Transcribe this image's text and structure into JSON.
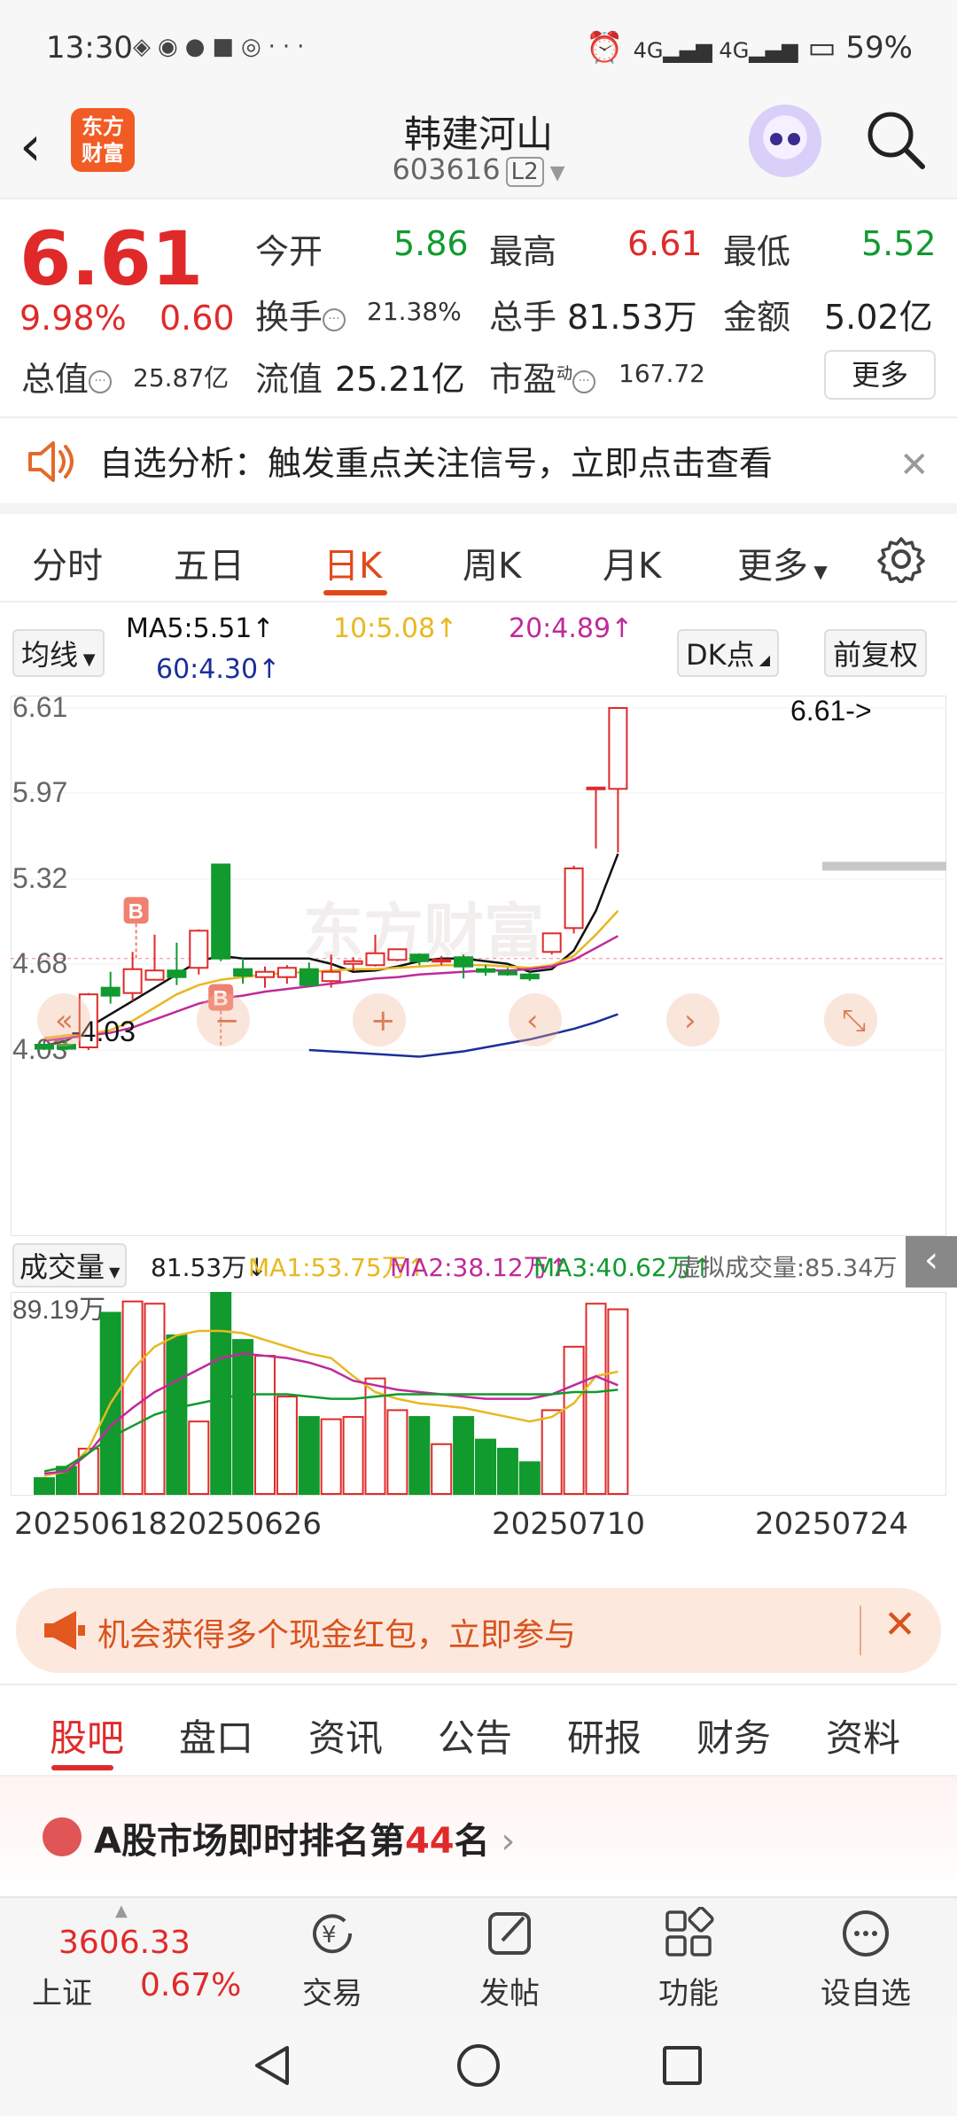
{
  "status_bar": {
    "time": "13:30",
    "battery": "59%",
    "more": "···"
  },
  "header": {
    "logo_line1": "东方",
    "logo_line2": "财富",
    "stock_name": "韩建河山",
    "stock_code": "603616",
    "level": "L2"
  },
  "quote": {
    "price": "6.61",
    "change_pct": "9.98%",
    "change_amt": "0.60",
    "open_label": "今开",
    "open": "5.86",
    "high_label": "最高",
    "high": "6.61",
    "low_label": "最低",
    "low": "5.52",
    "turnover_label": "换手",
    "turnover": "21.38%",
    "volume_label": "总手",
    "volume": "81.53万",
    "amount_label": "金额",
    "amount": "5.02亿",
    "mktcap_label": "总值",
    "mktcap": "25.87亿",
    "float_label": "流值",
    "float": "25.21亿",
    "pe_label": "市盈",
    "pe_sup": "动",
    "pe": "167.72",
    "more": "更多"
  },
  "alert": {
    "text": "自选分析：触发重点关注信号，立即点击查看"
  },
  "kline_tabs": [
    "分时",
    "五日",
    "日K",
    "周K",
    "月K",
    "更多"
  ],
  "ma_legend": {
    "selector": "均线",
    "ma5": "MA5:5.51↑",
    "ma10": "10:5.08↑",
    "ma20": "20:4.89↑",
    "ma60": "60:4.30↑",
    "dk": "DK点",
    "adjust": "前复权"
  },
  "colors": {
    "up": "#e02a2a",
    "down": "#119a2e",
    "ma5": "#111111",
    "ma10": "#e8b820",
    "ma20": "#c02a9a",
    "ma60": "#1a2f9a"
  },
  "chart_data": {
    "type": "candlestick",
    "y_ticks": [
      "6.61",
      "5.97",
      "5.32",
      "4.68",
      "4.03"
    ],
    "ylim": [
      4.03,
      6.61
    ],
    "current_marker": "6.61->",
    "low_marker": "4.03",
    "badge_b": "B",
    "watermark": "东方财富",
    "candles": [
      {
        "o": 4.07,
        "h": 4.1,
        "l": 4.03,
        "c": 4.04
      },
      {
        "o": 4.07,
        "h": 4.1,
        "l": 4.03,
        "c": 4.04
      },
      {
        "o": 4.05,
        "h": 4.46,
        "l": 4.03,
        "c": 4.45
      },
      {
        "o": 4.5,
        "h": 4.62,
        "l": 4.38,
        "c": 4.44
      },
      {
        "o": 4.46,
        "h": 4.77,
        "l": 4.4,
        "c": 4.64
      },
      {
        "o": 4.56,
        "h": 4.9,
        "l": 4.56,
        "c": 4.63
      },
      {
        "o": 4.63,
        "h": 4.84,
        "l": 4.52,
        "c": 4.58
      },
      {
        "o": 4.65,
        "h": 4.94,
        "l": 4.6,
        "c": 4.93
      },
      {
        "o": 5.43,
        "h": 5.43,
        "l": 4.7,
        "c": 4.72
      },
      {
        "o": 4.64,
        "h": 4.72,
        "l": 4.53,
        "c": 4.59
      },
      {
        "o": 4.58,
        "h": 4.66,
        "l": 4.5,
        "c": 4.62
      },
      {
        "o": 4.58,
        "h": 4.67,
        "l": 4.53,
        "c": 4.65
      },
      {
        "o": 4.64,
        "h": 4.69,
        "l": 4.51,
        "c": 4.52
      },
      {
        "o": 4.55,
        "h": 4.75,
        "l": 4.5,
        "c": 4.62
      },
      {
        "o": 4.68,
        "h": 4.73,
        "l": 4.63,
        "c": 4.7
      },
      {
        "o": 4.67,
        "h": 4.9,
        "l": 4.66,
        "c": 4.76
      },
      {
        "o": 4.71,
        "h": 4.79,
        "l": 4.7,
        "c": 4.79
      },
      {
        "o": 4.75,
        "h": 4.76,
        "l": 4.67,
        "c": 4.7
      },
      {
        "o": 4.71,
        "h": 4.74,
        "l": 4.67,
        "c": 4.71
      },
      {
        "o": 4.73,
        "h": 4.75,
        "l": 4.57,
        "c": 4.66
      },
      {
        "o": 4.64,
        "h": 4.67,
        "l": 4.59,
        "c": 4.62
      },
      {
        "o": 4.62,
        "h": 4.65,
        "l": 4.59,
        "c": 4.6
      },
      {
        "o": 4.6,
        "h": 4.62,
        "l": 4.55,
        "c": 4.57
      },
      {
        "o": 4.77,
        "h": 4.9,
        "l": 4.75,
        "c": 4.91
      },
      {
        "o": 4.95,
        "h": 5.42,
        "l": 4.91,
        "c": 5.4
      },
      {
        "o": 6.01,
        "h": 6.01,
        "l": 5.55,
        "c": 6.01
      },
      {
        "o": 6.0,
        "h": 6.61,
        "l": 5.52,
        "c": 6.61
      }
    ],
    "ma5": [
      4.06,
      4.1,
      4.2,
      4.3,
      4.4,
      4.5,
      4.6,
      4.7,
      4.74,
      4.72,
      4.72,
      4.72,
      4.72,
      4.68,
      4.62,
      4.63,
      4.66,
      4.7,
      4.72,
      4.72,
      4.7,
      4.68,
      4.62,
      4.64,
      4.78,
      5.08,
      5.51
    ],
    "ma10": [
      4.12,
      4.14,
      4.15,
      4.18,
      4.25,
      4.35,
      4.45,
      4.52,
      4.56,
      4.58,
      4.6,
      4.61,
      4.62,
      4.63,
      4.64,
      4.64,
      4.65,
      4.66,
      4.67,
      4.67,
      4.67,
      4.66,
      4.65,
      4.67,
      4.74,
      4.9,
      5.08
    ],
    "ma20": [
      4.1,
      4.12,
      4.14,
      4.16,
      4.2,
      4.26,
      4.32,
      4.38,
      4.42,
      4.44,
      4.47,
      4.49,
      4.51,
      4.53,
      4.55,
      4.57,
      4.58,
      4.6,
      4.61,
      4.62,
      4.63,
      4.63,
      4.64,
      4.66,
      4.71,
      4.8,
      4.89
    ],
    "ma60": [
      null,
      null,
      null,
      null,
      null,
      null,
      null,
      null,
      null,
      null,
      null,
      null,
      null,
      null,
      null,
      null,
      null,
      3.98,
      4.0,
      4.02,
      4.05,
      4.08,
      4.11,
      4.15,
      4.19,
      4.24,
      4.3
    ],
    "volume": {
      "label": "成交量",
      "current": "81.53万↓",
      "ma1": [
        8,
        10,
        20,
        40,
        55,
        65,
        70,
        72,
        72,
        71,
        68,
        65,
        62,
        60,
        52,
        45,
        42,
        40,
        39,
        38,
        36,
        34,
        32,
        34,
        40,
        52,
        54
      ],
      "ma2": [
        9,
        10,
        18,
        30,
        38,
        45,
        50,
        55,
        60,
        62,
        61,
        60,
        58,
        55,
        50,
        48,
        46,
        45,
        44,
        43,
        42,
        42,
        42,
        44,
        48,
        52,
        48
      ],
      "ma3": [
        10,
        12,
        18,
        25,
        30,
        35,
        38,
        40,
        42,
        44,
        44,
        44,
        43,
        42,
        42,
        43,
        44,
        44,
        44,
        44,
        44,
        44,
        44,
        44,
        45,
        45,
        46
      ],
      "virtual": "虚拟成交量:85.34万",
      "ymax_label": "89.19万",
      "ymax": 89.19,
      "bars": [
        7,
        12,
        20,
        80,
        85,
        84,
        70,
        32,
        99,
        68,
        61,
        43,
        34,
        33,
        34,
        51,
        37,
        34,
        22,
        34,
        24,
        20,
        14,
        37,
        65,
        84,
        81.53
      ]
    },
    "x_labels": [
      "20250618",
      "20250626",
      "20250710",
      "20250724"
    ]
  },
  "promo": {
    "text": "机会获得多个现金红包，立即参与"
  },
  "bottom_tabs": [
    "股吧",
    "盘口",
    "资讯",
    "公告",
    "研报",
    "财务",
    "资料"
  ],
  "rank": {
    "prefix": "A股市场即时排名第",
    "num": "44",
    "suffix": "名"
  },
  "bottom_nav": {
    "index_value": "3606.33",
    "index_name": "上证",
    "index_change": "0.67%",
    "items": [
      "交易",
      "发帖",
      "功能",
      "设自选"
    ]
  }
}
